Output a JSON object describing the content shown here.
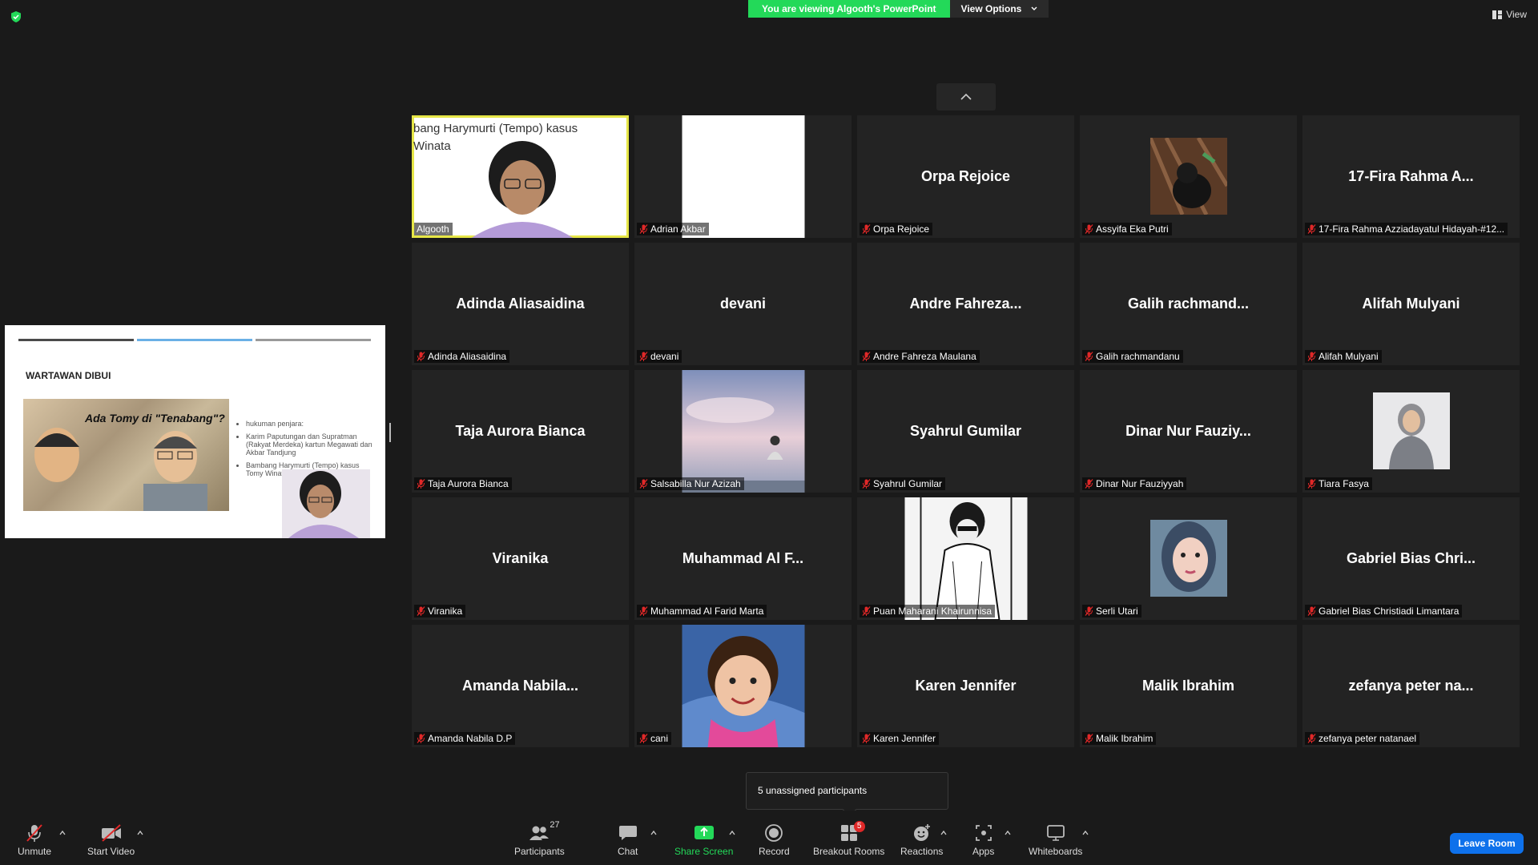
{
  "banner": {
    "viewing": "You are viewing Algooth's PowerPoint",
    "view_options": "View Options"
  },
  "view_button": "View",
  "shared_slide": {
    "title": "WARTAWAN DIBUI",
    "headline": "Ada Tomy di \"Tenabang\"?",
    "bullets": [
      "hukuman penjara:",
      "Karim Paputungan dan Supratman (Rakyat Merdeka) kartun Megawati dan Akbar Tandjung",
      "Bambang Harymurti (Tempo) kasus Tomy Winata"
    ],
    "bar_colors": [
      "#4a4a4a",
      "#6ab0e6",
      "#9a9a9a"
    ]
  },
  "speaker_overlay": [
    "bang Harymurti (Tempo) kasus",
    "Winata"
  ],
  "tiles": [
    {
      "big": "",
      "label": "Algooth",
      "kind": "speaker"
    },
    {
      "big": "",
      "label": "Adrian Akbar",
      "kind": "white"
    },
    {
      "big": "Orpa Rejoice",
      "label": "Orpa Rejoice"
    },
    {
      "big": "",
      "label": "Assyifa Eka Putri",
      "kind": "avatar-cat"
    },
    {
      "big": "17-Fira Rahma A...",
      "label": "17-Fira Rahma Azziadayatul Hidayah-#12..."
    },
    {
      "big": "Adinda Aliasaidina",
      "label": "Adinda Aliasaidina"
    },
    {
      "big": "devani",
      "label": "devani"
    },
    {
      "big": "Andre Fahreza...",
      "label": "Andre Fahreza Maulana"
    },
    {
      "big": "Galih rachmand...",
      "label": "Galih rachmandanu"
    },
    {
      "big": "Alifah Mulyani",
      "label": "Alifah Mulyani"
    },
    {
      "big": "Taja Aurora Bianca",
      "label": "Taja Aurora Bianca"
    },
    {
      "big": "",
      "label": "Salsabilla Nur Azizah",
      "kind": "sky"
    },
    {
      "big": "Syahrul Gumilar",
      "label": "Syahrul Gumilar"
    },
    {
      "big": "Dinar Nur Fauziy...",
      "label": "Dinar Nur Fauziyyah"
    },
    {
      "big": "",
      "label": "Tiara Fasya",
      "kind": "avatar-hijab"
    },
    {
      "big": "Viranika",
      "label": "Viranika"
    },
    {
      "big": "Muhammad Al F...",
      "label": "Muhammad Al Farid Marta"
    },
    {
      "big": "",
      "label": "Puan Maharani Khairunnisa",
      "kind": "manga"
    },
    {
      "big": "",
      "label": "Serli Utari",
      "kind": "avatar-selfie"
    },
    {
      "big": "Gabriel Bias Chri...",
      "label": "Gabriel Bias Christiadi Limantara"
    },
    {
      "big": "Amanda Nabila...",
      "label": "Amanda Nabila D.P"
    },
    {
      "big": "",
      "label": "cani",
      "kind": "child"
    },
    {
      "big": "Karen Jennifer",
      "label": "Karen Jennifer"
    },
    {
      "big": "Malik Ibrahim",
      "label": "Malik Ibrahim"
    },
    {
      "big": "zefanya peter na...",
      "label": "zefanya peter natanael"
    }
  ],
  "unassigned": "5 unassigned participants",
  "toolbar": {
    "unmute": "Unmute",
    "start_video": "Start Video",
    "participants": "Participants",
    "participants_count": "27",
    "chat": "Chat",
    "share_screen": "Share Screen",
    "record": "Record",
    "breakout_rooms": "Breakout Rooms",
    "breakout_badge": "5",
    "reactions": "Reactions",
    "apps": "Apps",
    "whiteboards": "Whiteboards",
    "leave": "Leave Room"
  },
  "colors": {
    "accent_green": "#23d959",
    "speaker_border": "#e6e647",
    "muted_red": "#e02828",
    "leave_blue": "#0e71eb"
  }
}
